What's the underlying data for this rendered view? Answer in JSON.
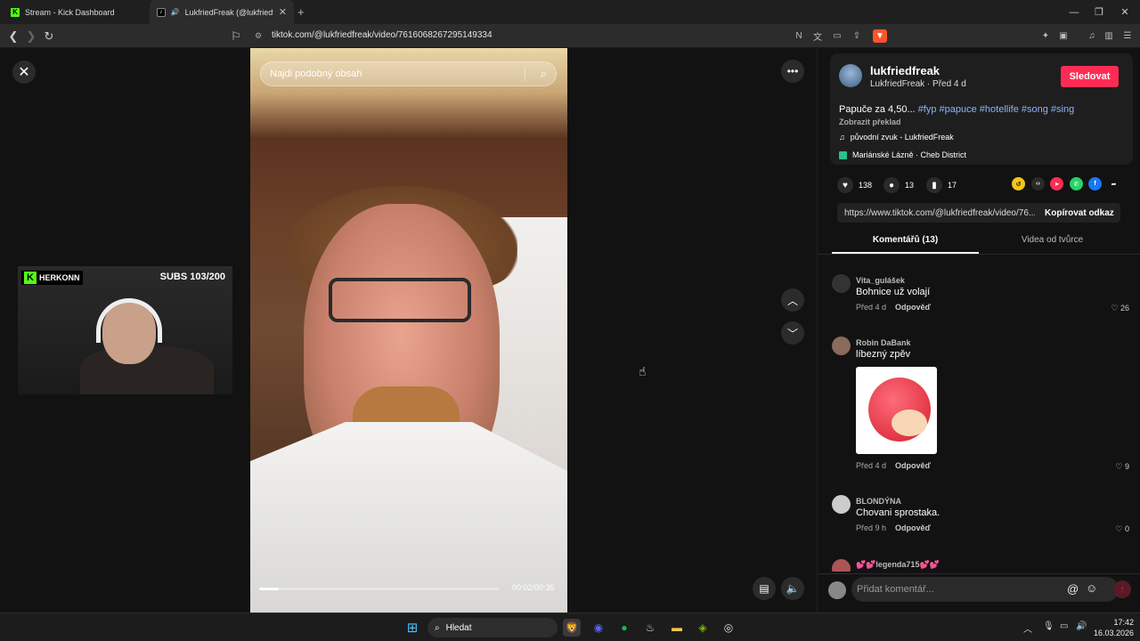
{
  "browser": {
    "tabs": [
      {
        "title": "Stream - Kick Dashboard"
      },
      {
        "title": "LukfriedFreak (@lukfriedfreak"
      }
    ],
    "url": "tiktok.com/@lukfriedfreak/video/7616068267295149334"
  },
  "player": {
    "search_placeholder": "Najdi podobný obsah",
    "time": "00:02/00:35",
    "progress": 0.08
  },
  "webcam": {
    "channel": "HERKONN",
    "subs": "SUBS 103/200"
  },
  "post": {
    "username": "lukfriedfreak",
    "meta": "LukfriedFreak · Před 4 d",
    "follow_label": "Sledovat",
    "desc_text": "Papuče za 4,50...",
    "hashtags": "#fyp #papuce #hotellife #song #sing",
    "translate": "Zobrazit překlad",
    "sound": "původní zvuk - LukfriedFreak",
    "location": "Mariánské Lázně · Cheb District",
    "likes": "138",
    "comments": "13",
    "saves": "17",
    "link": "https://www.tiktok.com/@lukfriedfreak/video/76...",
    "copy_label": "Kopírovat odkaz",
    "tab_comments": "Komentářů (13)",
    "tab_creator": "Videa od tvůrce"
  },
  "comments": [
    {
      "name": "Vita_gulášek",
      "text": "Bohnice už volají",
      "time": "Před 4 d",
      "reply": "Odpověď",
      "likes": "26"
    },
    {
      "name": "Robin DaBank",
      "text": "líbezný zpěv",
      "time": "Před 4 d",
      "reply": "Odpověď",
      "likes": "9"
    },
    {
      "name": "BLONDÝNA",
      "text": "Chovani sprostaka.",
      "time": "Před 9 h",
      "reply": "Odpověď",
      "likes": "0"
    },
    {
      "name": "legenda715"
    }
  ],
  "compose": {
    "placeholder": "Přidat komentář..."
  },
  "taskbar": {
    "search": "Hledat",
    "time": "17:42",
    "date": "16.03.2026"
  }
}
